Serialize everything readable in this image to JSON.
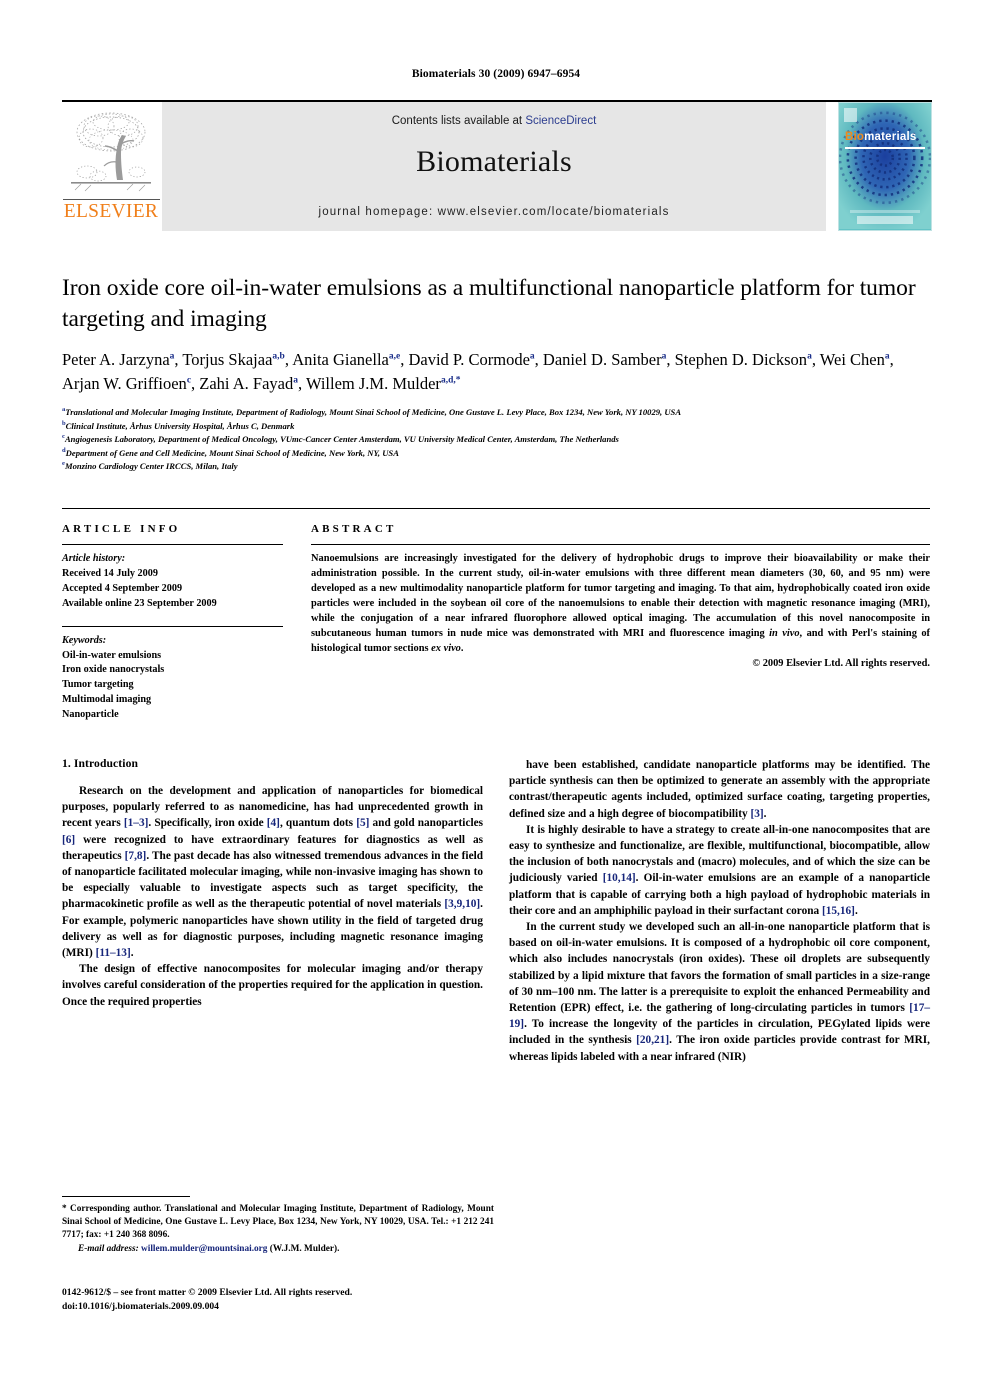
{
  "running_head": "Biomaterials 30 (2009) 6947–6954",
  "masthead": {
    "publisher_wordmark": "ELSEVIER",
    "contents_prefix": "Contents lists available at ",
    "contents_link": "ScienceDirect",
    "journal_name": "Biomaterials",
    "homepage": "journal homepage: www.elsevier.com/locate/biomaterials",
    "cover": {
      "title_part1": "Bio",
      "title_part2": "materials",
      "bg_color": "#63c3c6",
      "ring_color": "#1b3f9e",
      "orange": "#F08A1C"
    }
  },
  "article": {
    "title": "Iron oxide core oil-in-water emulsions as a multifunctional nanoparticle platform for tumor targeting and imaging",
    "authors": [
      {
        "name": "Peter A. Jarzyna",
        "marks": "a"
      },
      {
        "name": "Torjus Skajaa",
        "marks": "a,b"
      },
      {
        "name": "Anita Gianella",
        "marks": "a,e"
      },
      {
        "name": "David P. Cormode",
        "marks": "a"
      },
      {
        "name": "Daniel D. Samber",
        "marks": "a"
      },
      {
        "name": "Stephen D. Dickson",
        "marks": "a"
      },
      {
        "name": "Wei Chen",
        "marks": "a"
      },
      {
        "name": "Arjan W. Griffioen",
        "marks": "c"
      },
      {
        "name": "Zahi A. Fayad",
        "marks": "a"
      },
      {
        "name": "Willem J.M. Mulder",
        "marks": "a,d,*"
      }
    ],
    "affiliations": [
      {
        "mark": "a",
        "text": "Translational and Molecular Imaging Institute, Department of Radiology, Mount Sinai School of Medicine, One Gustave L. Levy Place, Box 1234, New York, NY 10029, USA"
      },
      {
        "mark": "b",
        "text": "Clinical Institute, Århus University Hospital, Århus C, Denmark"
      },
      {
        "mark": "c",
        "text": "Angiogenesis Laboratory, Department of Medical Oncology, VUmc-Cancer Center Amsterdam, VU University Medical Center, Amsterdam, The Netherlands"
      },
      {
        "mark": "d",
        "text": "Department of Gene and Cell Medicine, Mount Sinai School of Medicine, New York, NY, USA"
      },
      {
        "mark": "e",
        "text": "Monzino Cardiology Center IRCCS, Milan, Italy"
      }
    ]
  },
  "article_info": {
    "heading": "ARTICLE INFO",
    "history_label": "Article history:",
    "history": [
      "Received 14 July 2009",
      "Accepted 4 September 2009",
      "Available online 23 September 2009"
    ],
    "keywords_label": "Keywords:",
    "keywords": [
      "Oil-in-water emulsions",
      "Iron oxide nanocrystals",
      "Tumor targeting",
      "Multimodal imaging",
      "Nanoparticle"
    ]
  },
  "abstract": {
    "heading": "ABSTRACT",
    "text_part1": "Nanoemulsions are increasingly investigated for the delivery of hydrophobic drugs to improve their bioavailability or make their administration possible. In the current study, oil-in-water emulsions with three different mean diameters (30, 60, and 95 nm) were developed as a new multimodality nanoparticle platform for tumor targeting and imaging. To that aim, hydrophobically coated iron oxide particles were included in the soybean oil core of the nanoemulsions to enable their detection with magnetic resonance imaging (MRI), while the conjugation of a near infrared fluorophore allowed optical imaging. The accumulation of this novel nanocomposite in subcutaneous human tumors in nude mice was demonstrated with MRI and fluorescence imaging ",
    "italic1": "in vivo",
    "text_part2": ", and with Perl's staining of histological tumor sections ",
    "italic2": "ex vivo",
    "text_part3": ".",
    "copyright": "© 2009 Elsevier Ltd. All rights reserved."
  },
  "introduction": {
    "heading": "1. Introduction",
    "left_paragraphs": [
      "Research on the development and application of nanoparticles for biomedical purposes, popularly referred to as nanomedicine, has had unprecedented growth in recent years [1–3]. Specifically, iron oxide [4], quantum dots [5] and gold nanoparticles [6] were recognized to have extraordinary features for diagnostics as well as therapeutics [7,8]. The past decade has also witnessed tremendous advances in the field of nanoparticle facilitated molecular imaging, while non-invasive imaging has shown to be especially valuable to investigate aspects such as target specificity, the pharmacokinetic profile as well as the therapeutic potential of novel materials [3,9,10]. For example, polymeric nanoparticles have shown utility in the field of targeted drug delivery as well as for diagnostic purposes, including magnetic resonance imaging (MRI) [11–13].",
      "The design of effective nanocomposites for molecular imaging and/or therapy involves careful consideration of the properties required for the application in question. Once the required properties"
    ],
    "right_paragraphs": [
      "have been established, candidate nanoparticle platforms may be identified. The particle synthesis can then be optimized to generate an assembly with the appropriate contrast/therapeutic agents included, optimized surface coating, targeting properties, defined size and a high degree of biocompatibility [3].",
      "It is highly desirable to have a strategy to create all-in-one nanocomposites that are easy to synthesize and functionalize, are flexible, multifunctional, biocompatible, allow the inclusion of both nanocrystals and (macro) molecules, and of which the size can be judiciously varied [10,14]. Oil-in-water emulsions are an example of a nanoparticle platform that is capable of carrying both a high payload of hydrophobic materials in their core and an amphiphilic payload in their surfactant corona [15,16].",
      "In the current study we developed such an all-in-one nanoparticle platform that is based on oil-in-water emulsions. It is composed of a hydrophobic oil core component, which also includes nanocrystals (iron oxides). These oil droplets are subsequently stabilized by a lipid mixture that favors the formation of small particles in a size-range of 30 nm–100 nm. The latter is a prerequisite to exploit the enhanced Permeability and Retention (EPR) effect, i.e. the gathering of long-circulating particles in tumors [17–19]. To increase the longevity of the particles in circulation, PEGylated lipids were included in the synthesis [20,21]. The iron oxide particles provide contrast for MRI, whereas lipids labeled with a near infrared (NIR)"
    ]
  },
  "footnote": {
    "text": "* Corresponding author. Translational and Molecular Imaging Institute, Department of Radiology, Mount Sinai School of Medicine, One Gustave L. Levy Place, Box 1234, New York, NY 10029, USA. Tel.: +1 212 241 7717; fax: +1 240 368 8096.",
    "email_label": "E-mail address:",
    "email": "willem.mulder@mountsinai.org",
    "email_suffix": "(W.J.M. Mulder)."
  },
  "footer": {
    "issn_line": "0142-9612/$ – see front matter © 2009 Elsevier Ltd. All rights reserved.",
    "doi_line": "doi:10.1016/j.biomaterials.2009.09.004"
  }
}
